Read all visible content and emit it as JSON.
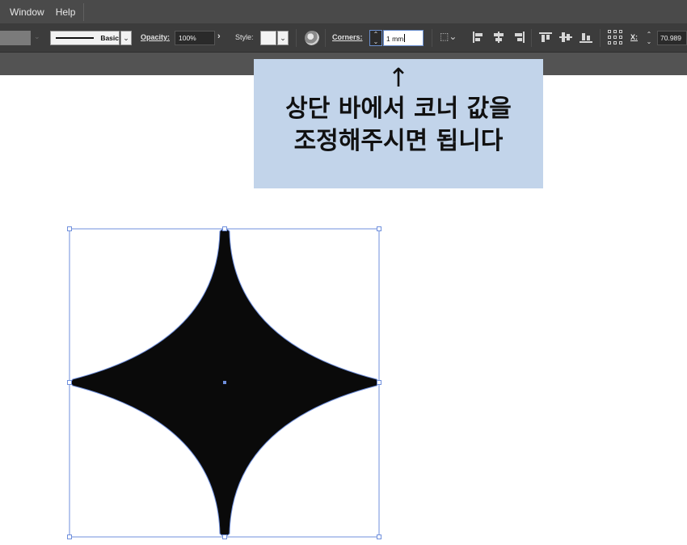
{
  "menu": {
    "items": [
      "Window",
      "Help"
    ]
  },
  "control_bar": {
    "stroke_profile_label": "Basic",
    "opacity_label": "Opacity:",
    "opacity_value": "100%",
    "style_label": "Style:",
    "corners_label": "Corners:",
    "corners_value": "1 mm",
    "x_label": "X:",
    "x_value": "70.989",
    "icons": {
      "dropdown": "chevron-down-icon",
      "opacity_more": "chevron-right-icon",
      "recolor": "recolor-artwork-icon",
      "stepper": "stepper-arrows-icon",
      "shape": "shape-options-icon",
      "align": [
        "align-left-icon",
        "align-horizontal-center-icon",
        "align-right-icon",
        "align-top-icon",
        "align-vertical-center-icon",
        "align-bottom-icon"
      ],
      "reference_point": "reference-point-grid-icon"
    }
  },
  "callout": {
    "arrow": "↑",
    "line1": "상단 바에서 코너 값을",
    "line2": "조정해주시면 됩니다",
    "background": "#c2d4ea"
  },
  "artwork": {
    "shape": "four-point-star",
    "fill": "#0a0a0a",
    "selection_color": "#6f8fdc"
  }
}
